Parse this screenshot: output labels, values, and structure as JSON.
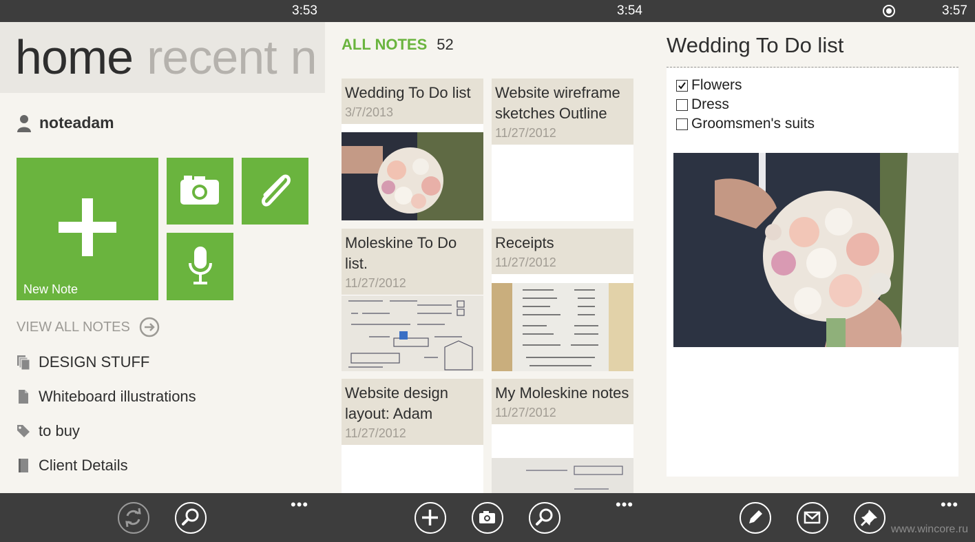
{
  "screen1": {
    "time": "3:53",
    "pivot": [
      "home",
      "recent",
      "n"
    ],
    "username": "noteadam",
    "tiles": {
      "new_note": "New Note"
    },
    "view_all": "VIEW ALL NOTES",
    "notebooks": [
      "DESIGN STUFF",
      "Whiteboard illustrations",
      "to buy",
      "Client Details"
    ],
    "appbar": {
      "dots": "•••"
    }
  },
  "screen2": {
    "time": "3:54",
    "header": {
      "label": "ALL NOTES",
      "count": "52"
    },
    "notes": [
      {
        "title": "Wedding To Do list",
        "date": "3/7/2013"
      },
      {
        "title": "Website wireframe sketches Outline",
        "date": "11/27/2012"
      },
      {
        "title": "Moleskine To Do list.",
        "date": "11/27/2012"
      },
      {
        "title": "Receipts",
        "date": "11/27/2012"
      },
      {
        "title": "Website design layout: Adam",
        "date": "11/27/2012"
      },
      {
        "title": "My Moleskine notes",
        "date": "11/27/2012"
      }
    ],
    "appbar": {
      "dots": "•••"
    }
  },
  "screen3": {
    "time": "3:57",
    "title": "Wedding To Do list",
    "checklist": [
      {
        "label": "Flowers",
        "checked": true
      },
      {
        "label": "Dress",
        "checked": false
      },
      {
        "label": "Groomsmen's suits",
        "checked": false
      }
    ],
    "appbar": {
      "dots": "•••"
    },
    "watermark": "www.wincore.ru"
  },
  "colors": {
    "accent": "#6ab43e",
    "chrome": "#3d3d3d",
    "background": "#f6f4ef",
    "card_header": "#e6e1d5"
  }
}
